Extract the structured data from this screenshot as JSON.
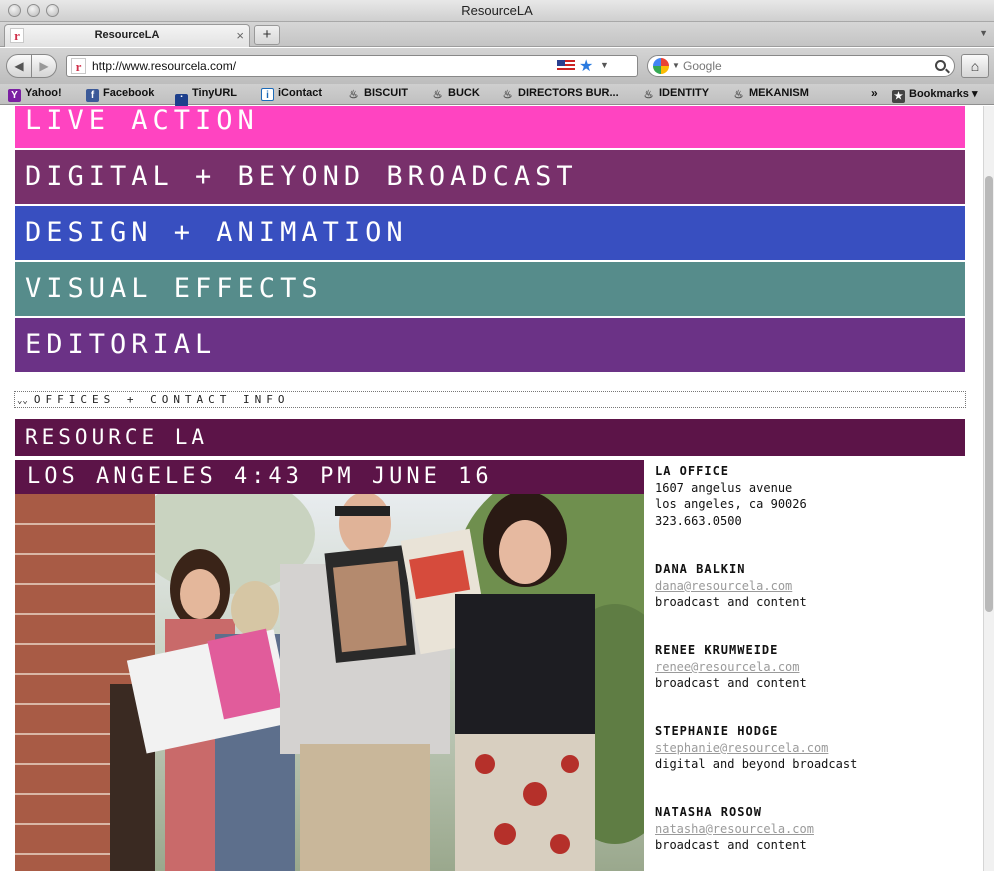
{
  "window": {
    "title": "ResourceLA"
  },
  "tabs": [
    {
      "label": "ResourceLA",
      "favicon_letter": "r"
    }
  ],
  "toolbar": {
    "url": "http://www.resourcela.com/",
    "search_placeholder": "Google"
  },
  "bookmarks": [
    {
      "label": "Yahoo!",
      "icon": "yahoo-icon"
    },
    {
      "label": "Facebook",
      "icon": "facebook-icon"
    },
    {
      "label": "TinyURL",
      "icon": "tinyurl-icon"
    },
    {
      "label": "iContact",
      "icon": "icontact-icon"
    },
    {
      "label": "BISCUIT",
      "icon": "flame-icon"
    },
    {
      "label": "BUCK",
      "icon": "flame-icon"
    },
    {
      "label": "DIRECTORS BUR...",
      "icon": "flame-icon"
    },
    {
      "label": "IDENTITY",
      "icon": "flame-icon"
    },
    {
      "label": "MEKANISM",
      "icon": "flame-icon"
    }
  ],
  "bookmarks_folder": "Bookmarks",
  "categories": [
    {
      "label": "LIVE ACTION",
      "color": "#ff44c1"
    },
    {
      "label": "DIGITAL + BEYOND BROADCAST",
      "color": "#78306b"
    },
    {
      "label": "DESIGN + ANIMATION",
      "color": "#384fc0"
    },
    {
      "label": "VISUAL EFFECTS",
      "color": "#568c8b"
    },
    {
      "label": "EDITORIAL",
      "color": "#6b3286"
    }
  ],
  "offices_toggle": "OFFICES + CONTACT INFO",
  "office_header": "RESOURCE LA",
  "clock": "LOS ANGELES 4:43 PM JUNE 16",
  "office": {
    "title": "LA OFFICE",
    "address1": "1607 angelus avenue",
    "address2": "los angeles, ca 90026",
    "phone": "323.663.0500"
  },
  "contacts": [
    {
      "name": "DANA BALKIN",
      "email": "dana@resourcela.com",
      "role": "broadcast and content"
    },
    {
      "name": "RENEE KRUMWEIDE",
      "email": "renee@resourcela.com",
      "role": "broadcast and content"
    },
    {
      "name": "STEPHANIE HODGE",
      "email": "stephanie@resourcela.com",
      "role": "digital and beyond broadcast"
    },
    {
      "name": "NATASHA ROSOW",
      "email": "natasha@resourcela.com",
      "role": "broadcast and content"
    }
  ]
}
